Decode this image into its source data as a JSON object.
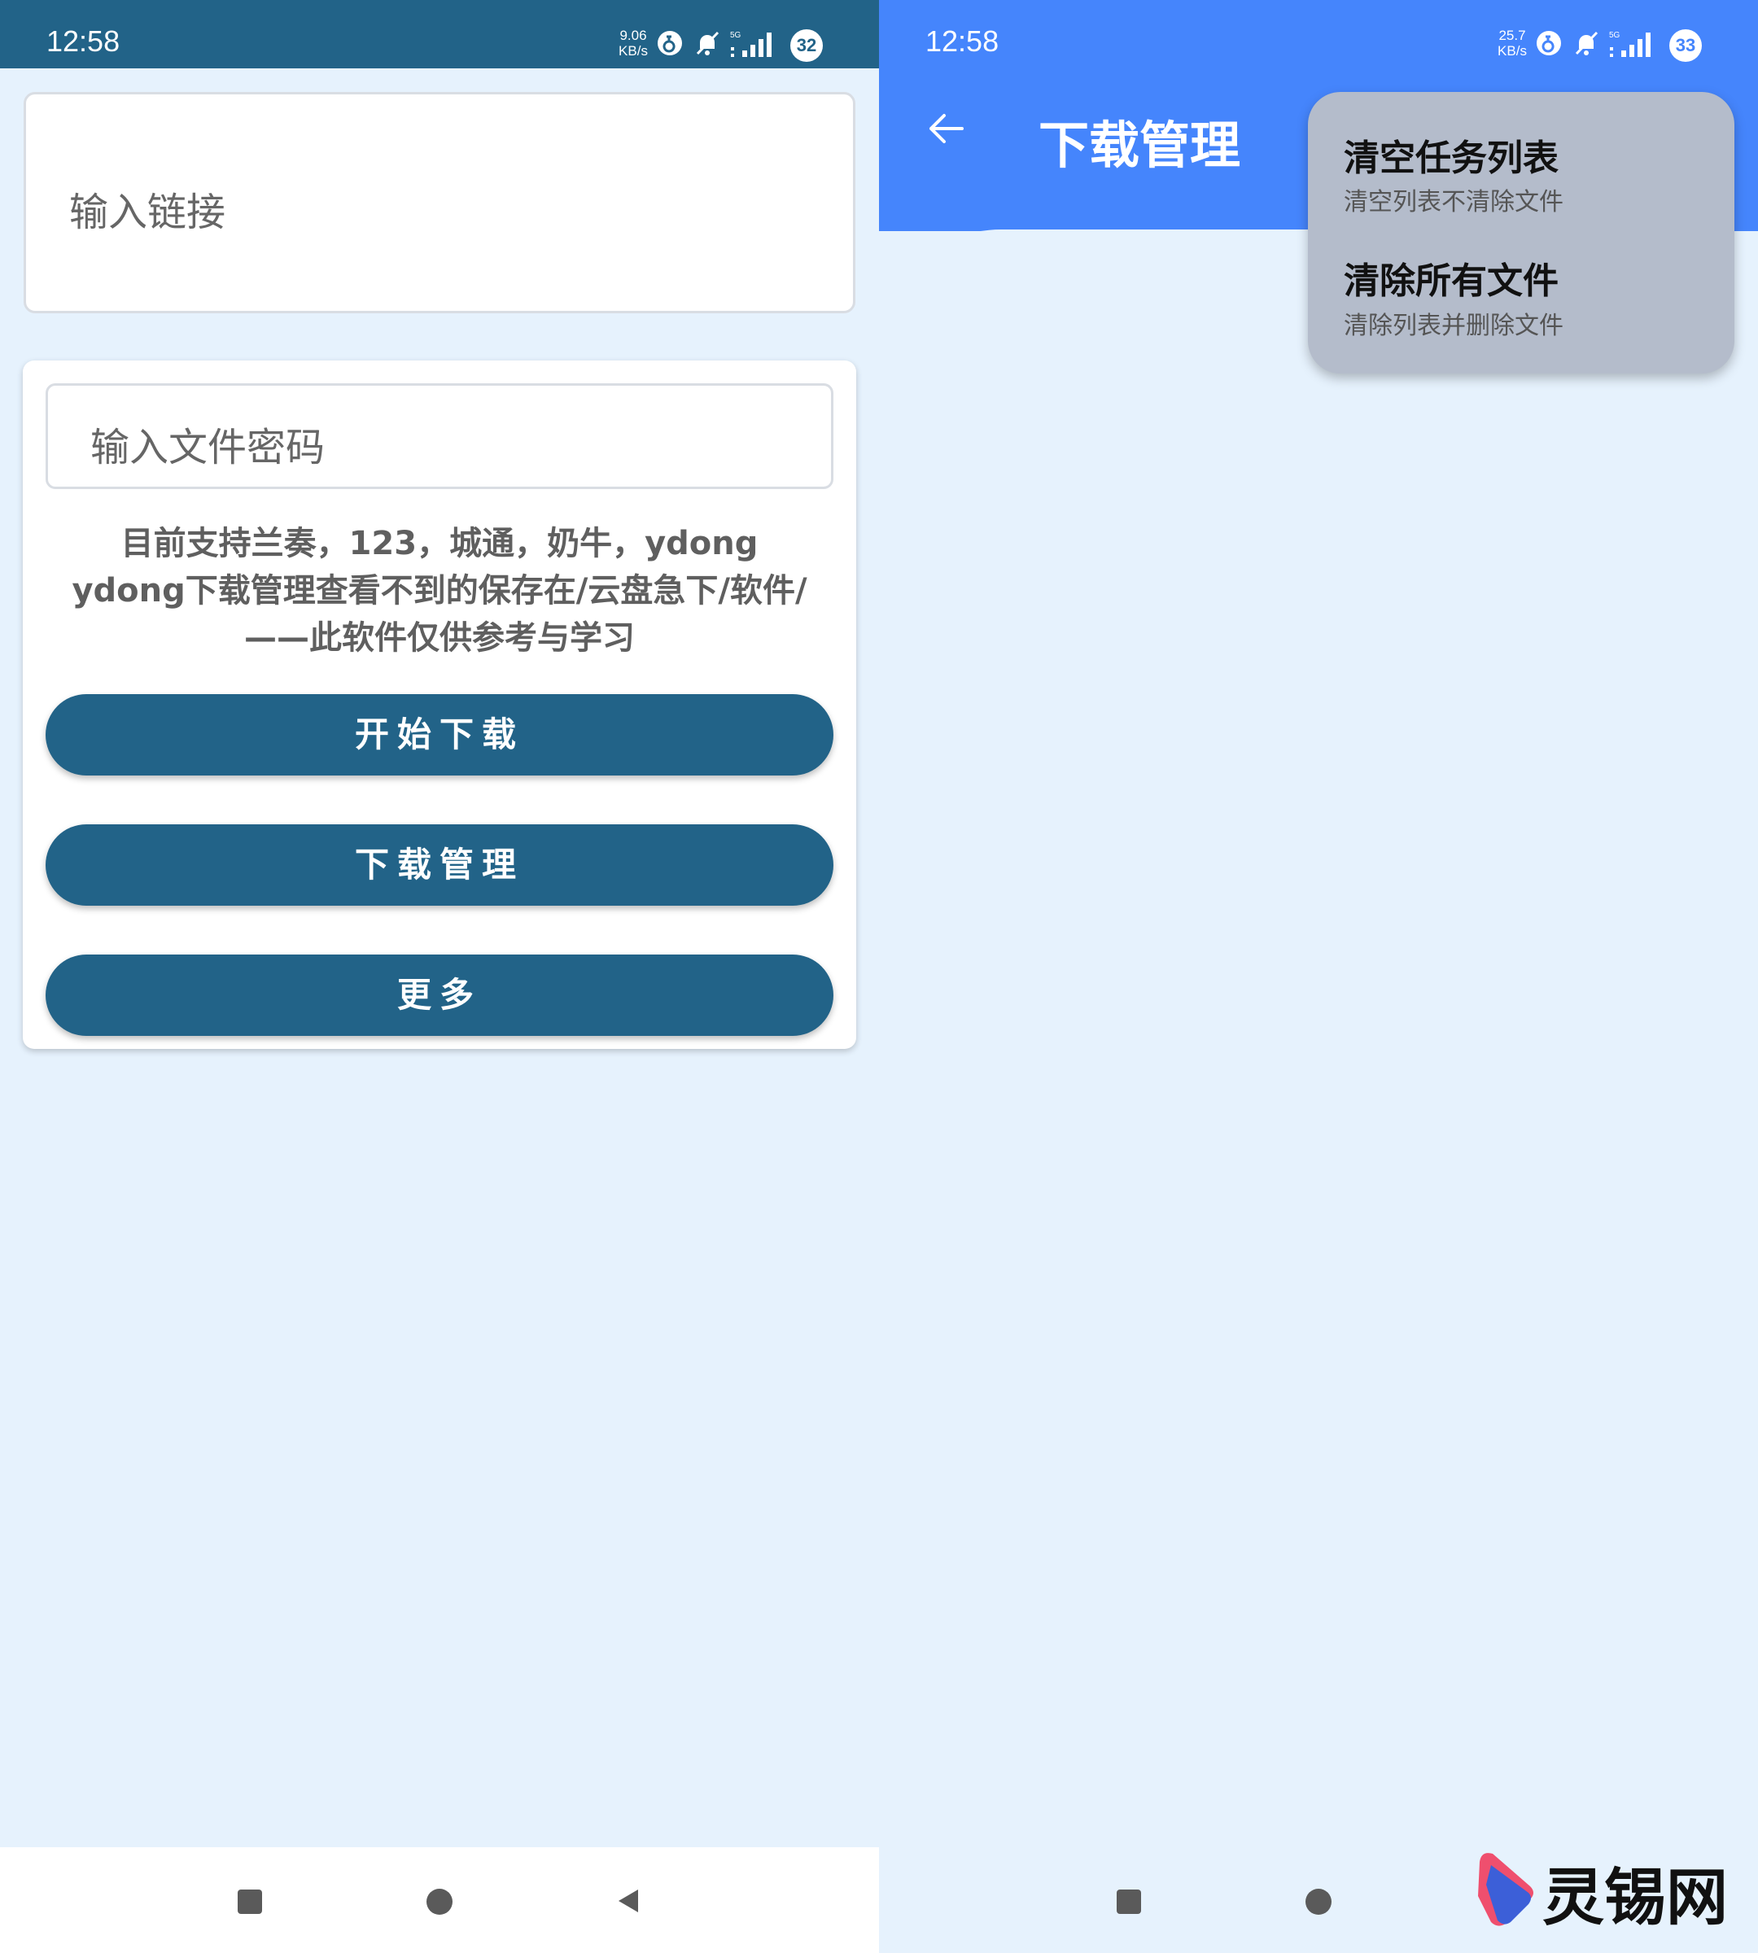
{
  "left": {
    "status": {
      "time": "12:58",
      "net_speed_value": "9.06",
      "net_speed_unit": "KB/s",
      "network": "5G",
      "battery": "32"
    },
    "link_input": {
      "placeholder": "输入链接"
    },
    "password_input": {
      "placeholder": "输入文件密码"
    },
    "info_lines": [
      "目前支持兰奏，123，城通，奶牛，ydong",
      "ydong下载管理查看不到的保存在/云盘急下/软件/",
      "——此软件仅供参考与学习"
    ],
    "buttons": {
      "start": "开始下载",
      "manage": "下载管理",
      "more": "更多"
    }
  },
  "right": {
    "status": {
      "time": "12:58",
      "net_speed_value": "25.7",
      "net_speed_unit": "KB/s",
      "network": "5G",
      "battery": "33"
    },
    "title": "下载管理",
    "menu": [
      {
        "title": "清空任务列表",
        "subtitle": "清空列表不清除文件"
      },
      {
        "title": "清除所有文件",
        "subtitle": "清除列表并删除文件"
      }
    ]
  },
  "watermark": {
    "text": "灵锡网"
  },
  "colors": {
    "primary": "#226388",
    "accent_blue": "#4585fc",
    "background": "#e6f2fd",
    "menu_bg": "#b4bccb"
  }
}
